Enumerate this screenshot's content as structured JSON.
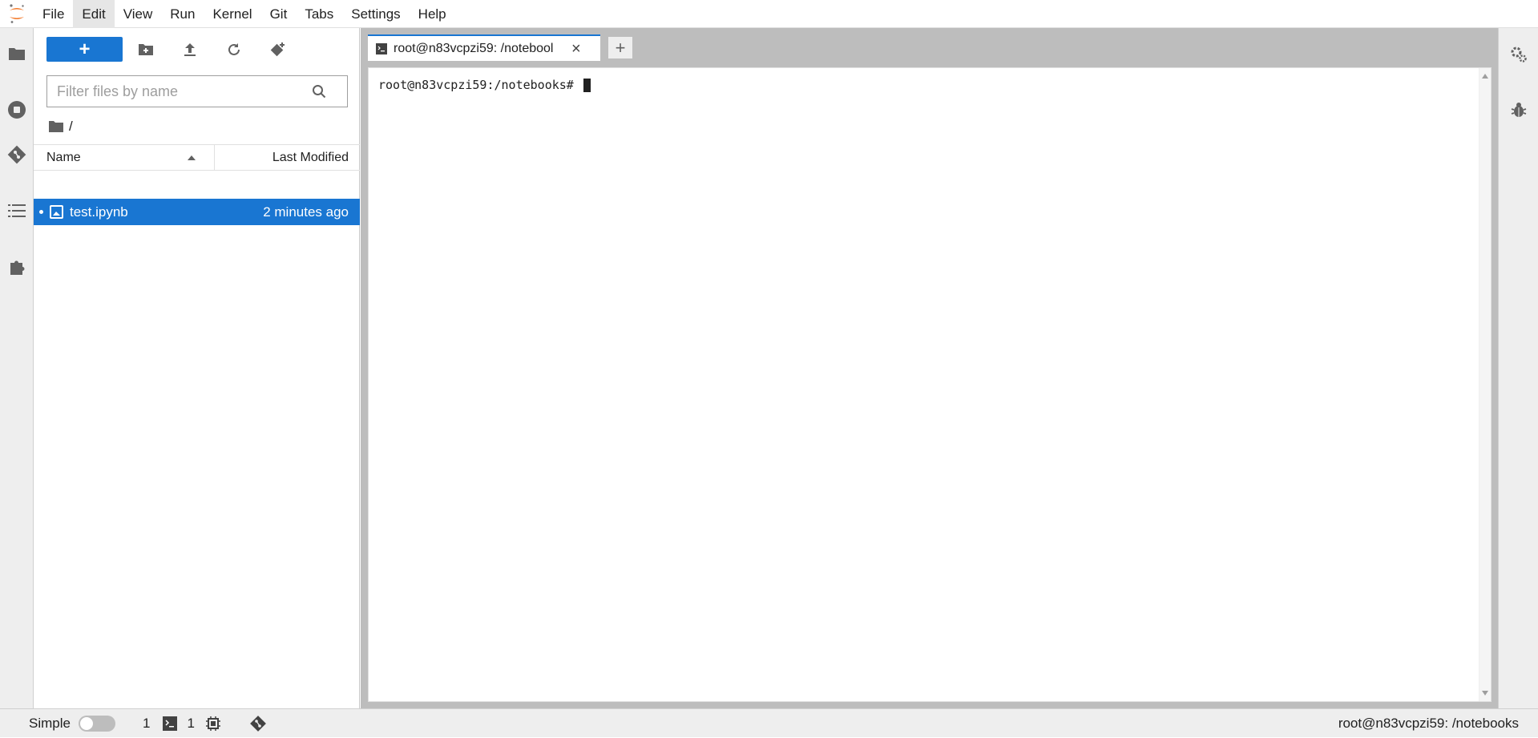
{
  "menubar": {
    "items": [
      "File",
      "Edit",
      "View",
      "Run",
      "Kernel",
      "Git",
      "Tabs",
      "Settings",
      "Help"
    ],
    "active": "Edit"
  },
  "left_sidebar": {
    "icons": [
      "folder-icon",
      "running-icon",
      "git-icon",
      "toc-icon",
      "extension-icon"
    ]
  },
  "file_browser": {
    "new_button_label": "+",
    "filter_placeholder": "Filter files by name",
    "breadcrumb_path": "/",
    "columns": {
      "name": "Name",
      "modified": "Last Modified"
    },
    "files": [
      {
        "name": "test.ipynb",
        "modified": "2 minutes ago",
        "selected": true
      }
    ]
  },
  "main": {
    "tab": {
      "label": "root@n83vcpzi59: /notebool",
      "close": "×"
    },
    "add_tab_label": "+",
    "terminal_prompt": "root@n83vcpzi59:/notebooks# "
  },
  "statusbar": {
    "simple_label": "Simple",
    "kernels_count": "1",
    "terminals_count": "1",
    "right_text": "root@n83vcpzi59: /notebooks"
  },
  "colors": {
    "accent": "#1976d2",
    "logo_orange": "#f37726"
  }
}
